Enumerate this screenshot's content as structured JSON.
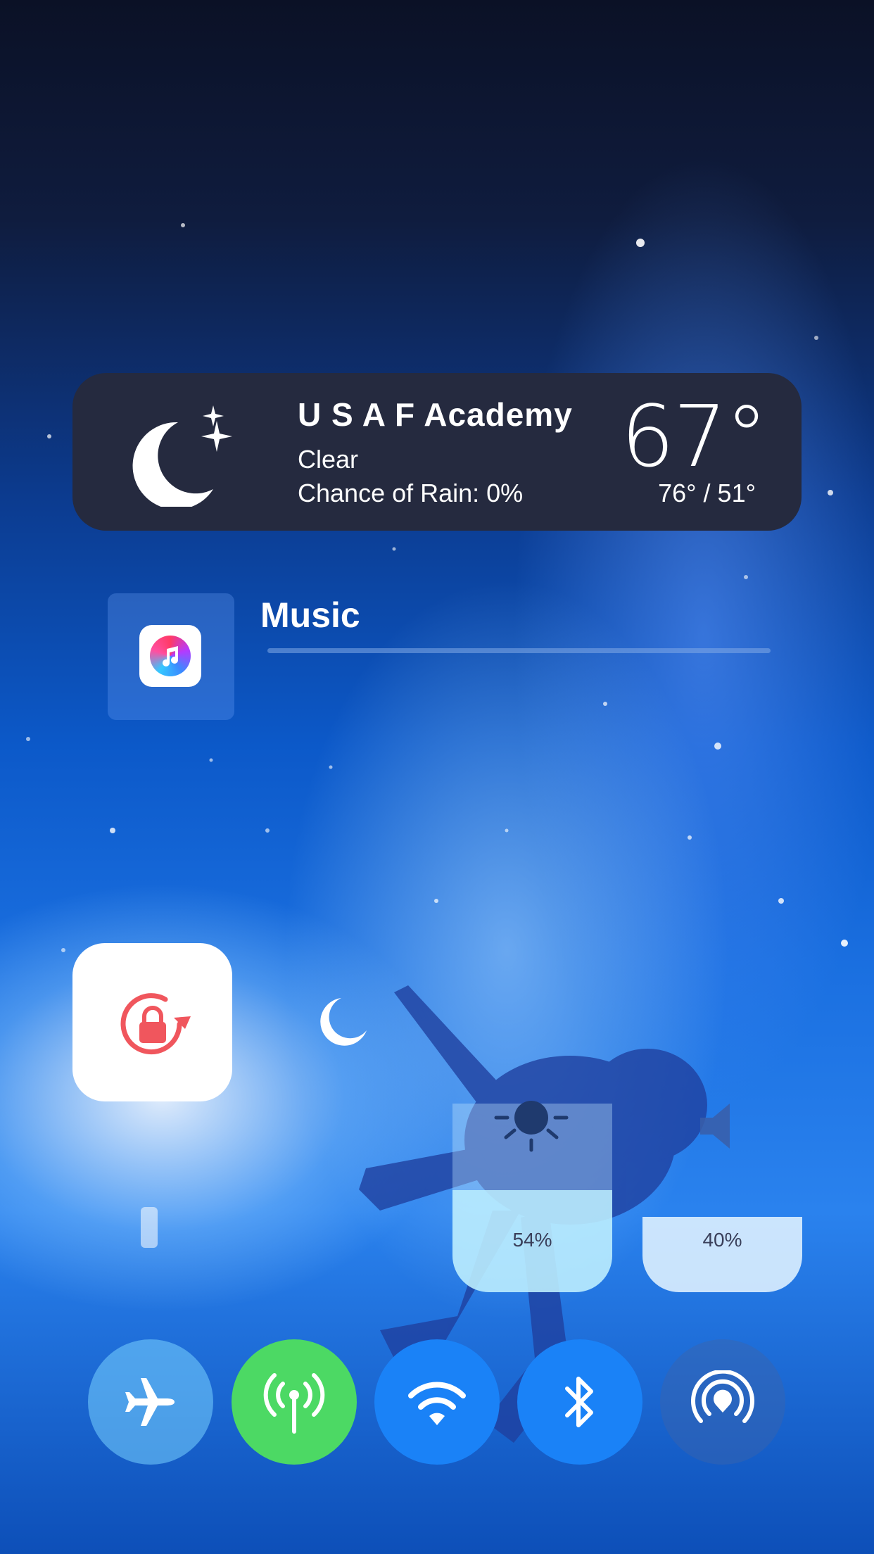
{
  "weather": {
    "location": "U S A F Academy",
    "condition": "Clear",
    "rain_chance": "Chance of Rain: 0%",
    "temperature": "67°",
    "high_low": "76° / 51°",
    "icon": "moon-stars-icon"
  },
  "music": {
    "title": "Music",
    "app_icon": "music-app-icon"
  },
  "controls": {
    "rotation_lock_icon": "rotation-lock-icon",
    "do_not_disturb_icon": "moon-icon",
    "flashlight_icon": "flashlight-icon",
    "brightness": {
      "label": "54%",
      "level": 0.54,
      "icon": "sun-icon"
    },
    "volume": {
      "label": "40%",
      "level": 0.4,
      "icon": "speaker-icon"
    },
    "toggles": [
      {
        "name": "airplane-mode",
        "icon": "airplane-icon",
        "state": "off"
      },
      {
        "name": "cellular-data",
        "icon": "antenna-icon",
        "state": "on",
        "color": "#4cd964"
      },
      {
        "name": "wifi",
        "icon": "wifi-icon",
        "state": "on",
        "color": "#1a82f7"
      },
      {
        "name": "bluetooth",
        "icon": "bluetooth-icon",
        "state": "on",
        "color": "#1a82f7"
      },
      {
        "name": "airdrop",
        "icon": "airdrop-icon",
        "state": "off"
      }
    ]
  },
  "colors": {
    "weather_bg": "#252a3f",
    "rotation_lock_red": "#f0565d",
    "accent_green": "#4cd964",
    "accent_blue": "#1a82f7"
  }
}
